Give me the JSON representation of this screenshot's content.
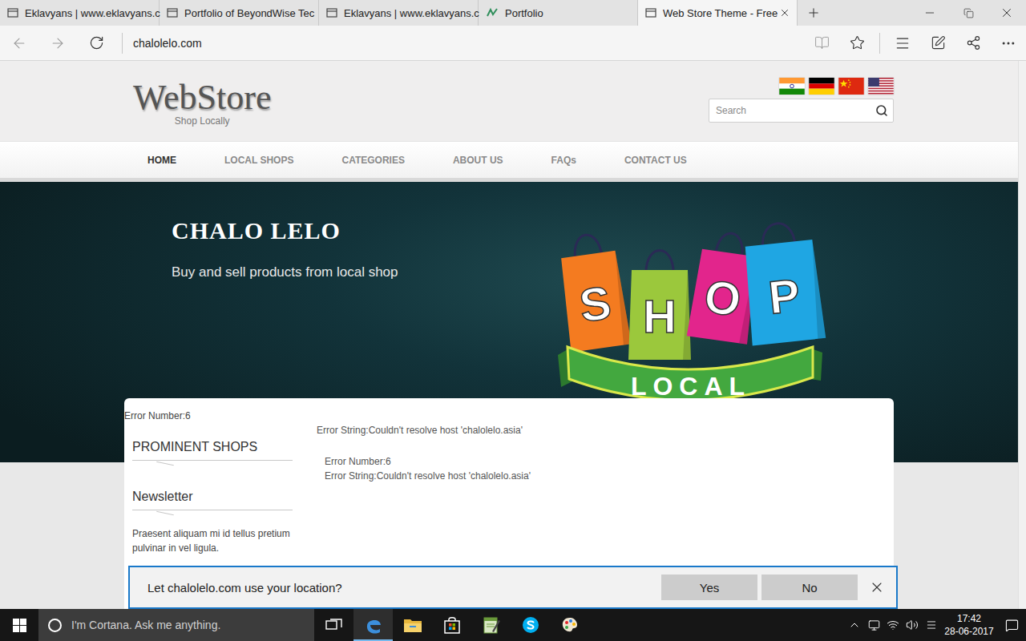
{
  "browser": {
    "tabs": [
      {
        "label": "Eklavyans | www.eklavyans.c",
        "kind": "page",
        "selected": false
      },
      {
        "label": "Portfolio of BeyondWise Tec",
        "kind": "page",
        "selected": false
      },
      {
        "label": "Eklavyans | www.eklavyans.c",
        "kind": "page",
        "selected": false
      },
      {
        "label": "Portfolio",
        "kind": "portfolio",
        "selected": false
      },
      {
        "label": "Web Store Theme - Free",
        "kind": "page",
        "selected": true
      }
    ],
    "address": "chalolelo.com"
  },
  "site": {
    "logo": {
      "title": "WebStore",
      "tagline": "Shop Locally"
    },
    "languages": [
      {
        "kind": "in"
      },
      {
        "kind": "de"
      },
      {
        "kind": "cn"
      },
      {
        "kind": "us"
      }
    ],
    "search": {
      "placeholder": "Search"
    },
    "nav": [
      {
        "label": "HOME",
        "selected": true
      },
      {
        "label": "LOCAL SHOPS",
        "selected": false
      },
      {
        "label": "CATEGORIES",
        "selected": false
      },
      {
        "label": "ABOUT US",
        "selected": false
      },
      {
        "label": "FAQs",
        "selected": false
      },
      {
        "label": "CONTACT US",
        "selected": false
      }
    ],
    "banner": {
      "title": "CHALO LELO",
      "subtitle": "Buy and sell products from local shop",
      "bags": [
        {
          "letter": "S",
          "color": "#f47b20"
        },
        {
          "letter": "H",
          "color": "#9bc83c"
        },
        {
          "letter": "O",
          "color": "#e2258c"
        },
        {
          "letter": "P",
          "color": "#1fa6e3"
        }
      ],
      "ribbon": "LOCAL"
    },
    "card": {
      "top_error": "Error Number:6",
      "sidebar": [
        {
          "title": "PROMINENT SHOPS"
        },
        {
          "title": "Newsletter",
          "text": "Praesent aliquam mi id tellus pretium pulvinar in vel ligula."
        }
      ],
      "main": {
        "message": "Error String:Couldn't resolve host 'chalolelo.asia'",
        "details": [
          "Error Number:6",
          "Error String:Couldn't resolve host 'chalolelo.asia'"
        ]
      }
    }
  },
  "location_prompt": {
    "text": "Let chalolelo.com use your location?",
    "buttons": [
      "Yes",
      "No"
    ]
  },
  "taskbar": {
    "search": {
      "placeholder": "I'm Cortana. Ask me anything."
    },
    "apps": [
      {
        "kind": "task-view",
        "active": false
      },
      {
        "kind": "edge",
        "active": true
      },
      {
        "kind": "explorer",
        "active": false
      },
      {
        "kind": "store",
        "active": false
      },
      {
        "kind": "notes",
        "active": false
      },
      {
        "kind": "skype",
        "active": false
      },
      {
        "kind": "paint",
        "active": false
      }
    ],
    "clock": {
      "time": "17:42",
      "date": "28-06-2017"
    }
  }
}
